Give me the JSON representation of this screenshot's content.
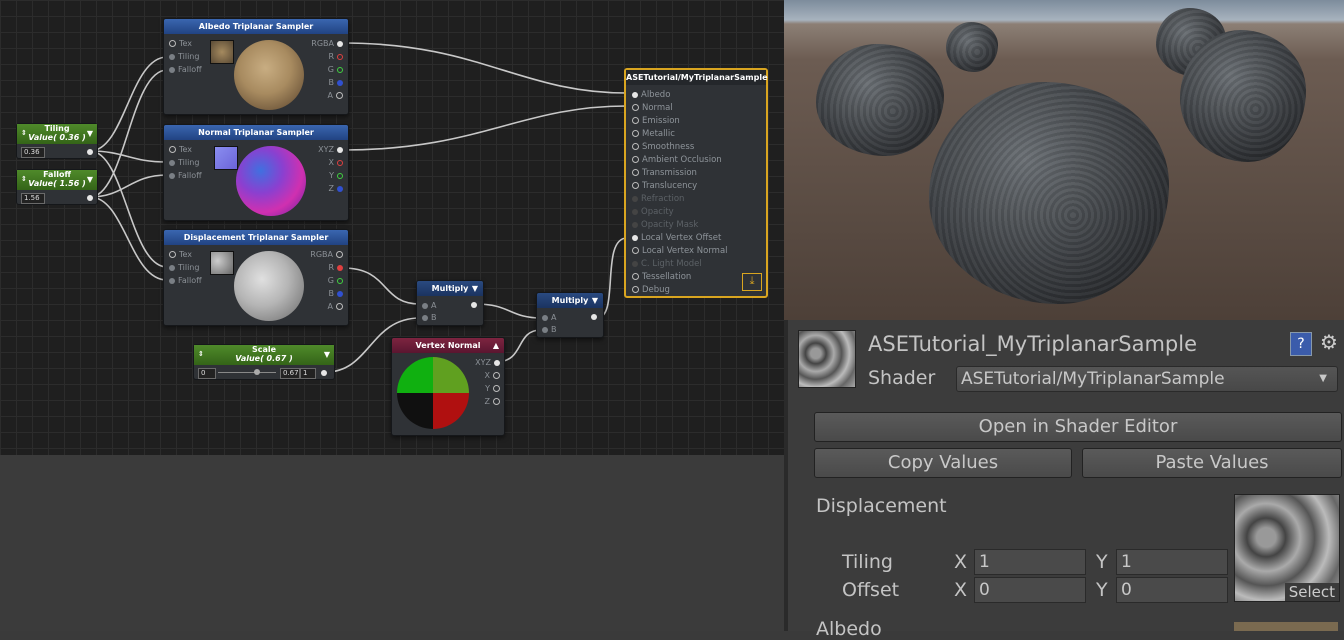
{
  "nodes": {
    "albedo": {
      "title": "Albedo Triplanar Sampler",
      "inputs": [
        "Tex",
        "Tiling",
        "Falloff"
      ],
      "outputs": [
        "RGBA",
        "R",
        "G",
        "B",
        "A"
      ]
    },
    "normal": {
      "title": "Normal Triplanar Sampler",
      "inputs": [
        "Tex",
        "Tiling",
        "Falloff"
      ],
      "outputs": [
        "XYZ",
        "X",
        "Y",
        "Z"
      ]
    },
    "displacement": {
      "title": "Displacement Triplanar Sampler",
      "inputs": [
        "Tex",
        "Tiling",
        "Falloff"
      ],
      "outputs": [
        "RGBA",
        "R",
        "G",
        "B",
        "A"
      ]
    },
    "multiply1": {
      "title": "Multiply",
      "inputs": [
        "A",
        "B"
      ]
    },
    "multiply2": {
      "title": "Multiply",
      "inputs": [
        "A",
        "B"
      ]
    },
    "vertex_normal": {
      "title": "Vertex Normal",
      "outputs": [
        "XYZ",
        "X",
        "Y",
        "Z"
      ]
    },
    "tiling": {
      "title": "Tiling",
      "subtitle": "Value( 0.36 )",
      "field": "0.36"
    },
    "falloff": {
      "title": "Falloff",
      "subtitle": "Value( 1.56 )",
      "field": "1.56"
    },
    "scale": {
      "title": "Scale",
      "subtitle": "Value( 0.67 )",
      "min": "0",
      "value": "0.67",
      "max": "1"
    },
    "master": {
      "title": "ASETutorial/MyTriplanarSample",
      "ports": [
        "Albedo",
        "Normal",
        "Emission",
        "Metallic",
        "Smoothness",
        "Ambient Occlusion",
        "Transmission",
        "Translucency",
        "Refraction",
        "Opacity",
        "Opacity Mask",
        "Local Vertex Offset",
        "Local Vertex Normal",
        "C. Light Model",
        "Tessellation",
        "Debug"
      ]
    }
  },
  "inspector": {
    "material_name": "ASETutorial_MyTriplanarSample",
    "shader_label": "Shader",
    "shader_value": "ASETutorial/MyTriplanarSample",
    "open_button": "Open in Shader Editor",
    "copy_button": "Copy Values",
    "paste_button": "Paste Values",
    "section_displacement": "Displacement",
    "tiling_label": "Tiling",
    "offset_label": "Offset",
    "x_label": "X",
    "y_label": "Y",
    "tiling_x": "1",
    "tiling_y": "1",
    "offset_x": "0",
    "offset_y": "0",
    "select_label": "Select",
    "section_albedo": "Albedo"
  },
  "colors": {
    "master_border": "#d9a520",
    "param_header": "#4f8a2a",
    "sampler_header": "#3a66b0",
    "vertex_header": "#7d2440"
  }
}
